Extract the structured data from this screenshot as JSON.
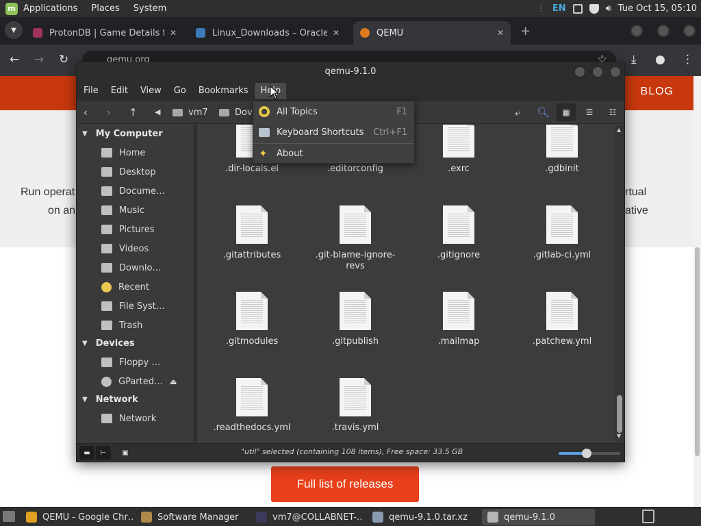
{
  "top_panel": {
    "menus": [
      "Applications",
      "Places",
      "System"
    ],
    "lang": "EN",
    "clock": "Tue Oct 15, 05:10"
  },
  "browser": {
    "tabs": [
      {
        "title": "ProtonDB | Game Details for",
        "favicon_color": "#a0325a"
      },
      {
        "title": "Linux_Downloads – Oracle V",
        "favicon_color": "#3d7ab8"
      },
      {
        "title": "QEMU",
        "favicon_color": "#e07a1f"
      }
    ],
    "url": "qemu.org",
    "blog_link": "BLOG",
    "bg_text_left_1": "Run operat",
    "bg_text_left_2": "on an",
    "bg_text_right_1": "rtual",
    "bg_text_right_2": "ative",
    "releases_button": "Full list of releases"
  },
  "nemo": {
    "title": "qemu-9.1.0",
    "menubar": [
      "File",
      "Edit",
      "View",
      "Go",
      "Bookmarks",
      "Help"
    ],
    "breadcrumb": [
      "vm7",
      "Dov"
    ],
    "sidebar": {
      "my_computer": {
        "heading": "My Computer",
        "items": [
          "Home",
          "Desktop",
          "Docume…",
          "Music",
          "Pictures",
          "Videos",
          "Downlo…",
          "Recent",
          "File Syst…",
          "Trash"
        ]
      },
      "devices": {
        "heading": "Devices",
        "items": [
          "Floppy …",
          "GParted…"
        ]
      },
      "network": {
        "heading": "Network",
        "items": [
          "Network"
        ]
      }
    },
    "files": [
      ".dir-locals.el",
      ".editorconfig",
      ".exrc",
      ".gdbinit",
      ".gitattributes",
      ".git-blame-ignore-revs",
      ".gitignore",
      ".gitlab-ci.yml",
      ".gitmodules",
      ".gitpublish",
      ".mailmap",
      ".patchew.yml",
      ".readthedocs.yml",
      ".travis.yml"
    ],
    "status": "\"util\" selected (containing 108 items), Free space: 33.5 GB",
    "zoom_level_fraction": 0.45
  },
  "help_menu": {
    "items": [
      {
        "label": "All Topics",
        "accel": "F1"
      },
      {
        "label": "Keyboard Shortcuts",
        "accel": "Ctrl+F1"
      },
      {
        "label": "About",
        "accel": ""
      }
    ]
  },
  "taskbar": {
    "tasks": [
      {
        "label": "QEMU - Google Chr…",
        "icon_color": "#e0a020"
      },
      {
        "label": "Software Manager",
        "icon_color": "#b08a4a"
      },
      {
        "label": "vm7@COLLABNET-…",
        "icon_color": "#3a3a5a"
      },
      {
        "label": "qemu-9.1.0.tar.xz",
        "icon_color": "#8a9ab0"
      },
      {
        "label": "qemu-9.1.0",
        "icon_color": "#b5b5b5"
      }
    ]
  }
}
